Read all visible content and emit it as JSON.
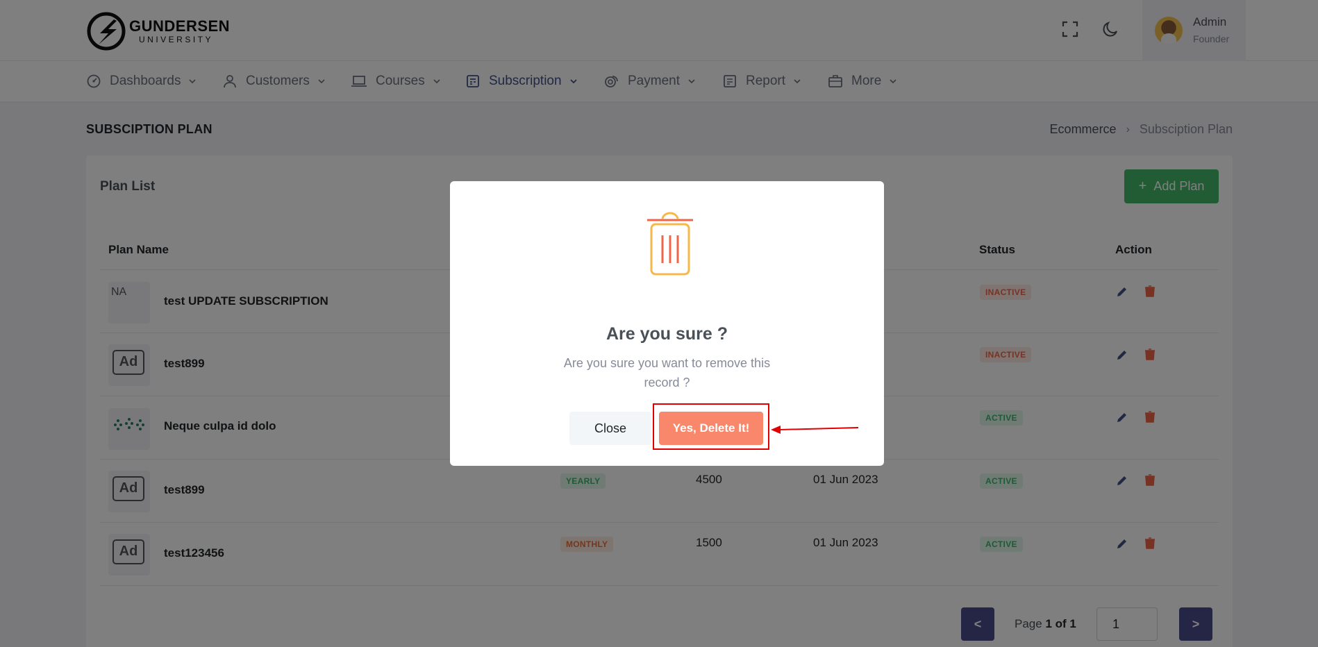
{
  "brand": {
    "name": "GUNDERSEN",
    "sub": "UNIVERSITY"
  },
  "header": {
    "fullscreen_icon": "fullscreen-icon",
    "theme_icon": "moon-icon",
    "user": {
      "name": "Admin",
      "role": "Founder"
    }
  },
  "nav": [
    {
      "label": "Dashboards",
      "icon": "dashboard-icon"
    },
    {
      "label": "Customers",
      "icon": "user-icon"
    },
    {
      "label": "Courses",
      "icon": "laptop-icon"
    },
    {
      "label": "Subscription",
      "icon": "subscription-icon",
      "active": true
    },
    {
      "label": "Payment",
      "icon": "coins-icon"
    },
    {
      "label": "Report",
      "icon": "report-icon"
    },
    {
      "label": "More",
      "icon": "briefcase-icon"
    }
  ],
  "page": {
    "title": "SUBSCIPTION PLAN",
    "breadcrumb": [
      "Ecommerce",
      "Subsciption Plan"
    ]
  },
  "card": {
    "title": "Plan List",
    "add_button": "Add Plan",
    "columns": {
      "plan_name": "Plan Name",
      "status": "Status",
      "action": "Action"
    },
    "rows": [
      {
        "thumb": "NA",
        "name": "test UPDATE SUBSCRIPTION",
        "status": "INACTIVE"
      },
      {
        "thumb": "Ad",
        "name": "test899",
        "status": "INACTIVE"
      },
      {
        "thumb": "tree",
        "name": "Neque culpa id dolo",
        "status": "ACTIVE"
      },
      {
        "thumb": "Ad",
        "name": "test899",
        "cycle": "YEARLY",
        "price": "4500",
        "date": "01 Jun 2023",
        "status": "ACTIVE"
      },
      {
        "thumb": "Ad",
        "name": "test123456",
        "cycle": "MONTHLY",
        "price": "1500",
        "date": "01 Jun 2023",
        "status": "ACTIVE"
      }
    ]
  },
  "pagination": {
    "prev": "<",
    "next": ">",
    "page_word": "Page",
    "page_info": "1 of 1",
    "input_value": "1"
  },
  "modal": {
    "title": "Are you sure ?",
    "message": "Are you sure you want to remove this record ?",
    "close_label": "Close",
    "confirm_label": "Yes, Delete It!"
  },
  "colors": {
    "primary": "#405189",
    "success": "#45b86a",
    "danger": "#f06548",
    "confirm": "#f9876b",
    "highlight": "#e00000"
  }
}
